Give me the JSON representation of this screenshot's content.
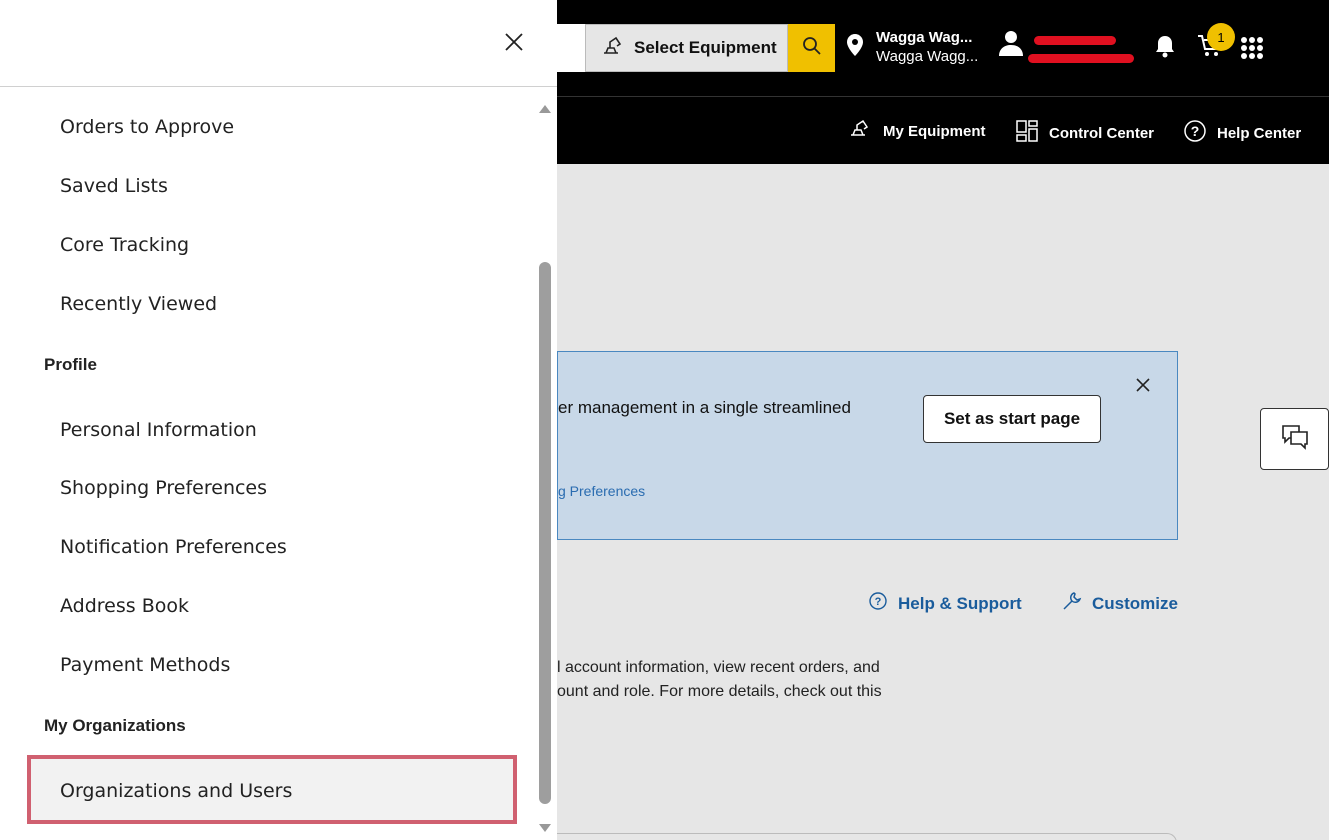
{
  "header": {
    "select_equipment_label": "Select Equipment",
    "location": {
      "line1": "Wagga Wag...",
      "line2": "Wagga Wagg..."
    },
    "cart_count": "1"
  },
  "nav": {
    "my_equipment": "My Equipment",
    "control_center": "Control Center",
    "help_center": "Help Center"
  },
  "banner": {
    "text": "er management in a single streamlined",
    "link": "g Preferences",
    "start_button": "Set as start page"
  },
  "links": {
    "help_support": "Help & Support",
    "customize": "Customize"
  },
  "description": {
    "line1": "l account information, view recent orders, and",
    "line2": "ount and role. For more details, check out this"
  },
  "drawer": {
    "items_top": [
      "Orders to Approve",
      "Saved Lists",
      "Core Tracking",
      "Recently Viewed"
    ],
    "profile_heading": "Profile",
    "profile_items": [
      "Personal Information",
      "Shopping Preferences",
      "Notification Preferences",
      "Address Book",
      "Payment Methods"
    ],
    "orgs_heading": "My Organizations",
    "orgs_items": [
      "Organizations and Users"
    ]
  },
  "colors": {
    "accent_yellow": "#f0c000",
    "link_blue": "#1a5c9c",
    "highlight_border": "#d06070",
    "banner_bg": "#c8d8e8"
  }
}
